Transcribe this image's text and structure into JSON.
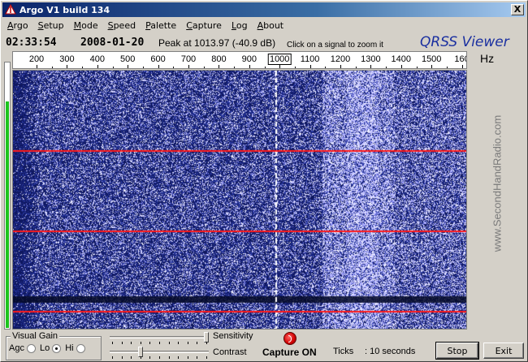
{
  "window": {
    "title": "Argo V1 build 134",
    "close_label": "X"
  },
  "menu": [
    {
      "label": "Argo",
      "u": "A",
      "rest": "rgo"
    },
    {
      "label": "Setup",
      "u": "S",
      "rest": "etup"
    },
    {
      "label": "Mode",
      "u": "M",
      "rest": "ode"
    },
    {
      "label": "Speed",
      "u": "S",
      "rest": "peed"
    },
    {
      "label": "Palette",
      "u": "P",
      "rest": "alette"
    },
    {
      "label": "Capture",
      "u": "C",
      "rest": "apture"
    },
    {
      "label": "Log",
      "u": "L",
      "rest": "og"
    },
    {
      "label": "About",
      "u": "A",
      "rest": "bout"
    }
  ],
  "info": {
    "time": "02:33:54",
    "date": "2008-01-20",
    "peak": "Peak at 1013.97 (-40.9 dB)",
    "hint": "Click on a signal to zoom it",
    "brand": "QRSS Viewer"
  },
  "scale": {
    "unit": "Hz",
    "labels": [
      "200",
      "300",
      "400",
      "500",
      "600",
      "700",
      "800",
      "900",
      "1000",
      "1100",
      "1200",
      "1300",
      "1400",
      "1500",
      "160"
    ],
    "highlight": "1000"
  },
  "level_meter": {
    "level": 0.85,
    "color": "#1ec41e"
  },
  "watermark": "www.SecondHandRadio.com",
  "waterfall": {
    "base_color": "#0f1860",
    "noise_color": "#ffffff",
    "marker_color": "#ff1a1a",
    "signal_label": "1000"
  },
  "visual_gain": {
    "legend": "Visual Gain",
    "agc_label": "Agc",
    "lo_label": "Lo",
    "hi_label": "Hi",
    "selected": "Lo"
  },
  "controls": {
    "sensitivity_label": "Sensitivity",
    "contrast_label": "Contrast",
    "sensitivity_value": 1.0,
    "contrast_value": 0.3
  },
  "capture": {
    "label": "Capture ON",
    "ticks_label": "Ticks",
    "ticks_value": ": 10 seconds"
  },
  "buttons": {
    "stop": "Stop",
    "exit": "Exit"
  }
}
